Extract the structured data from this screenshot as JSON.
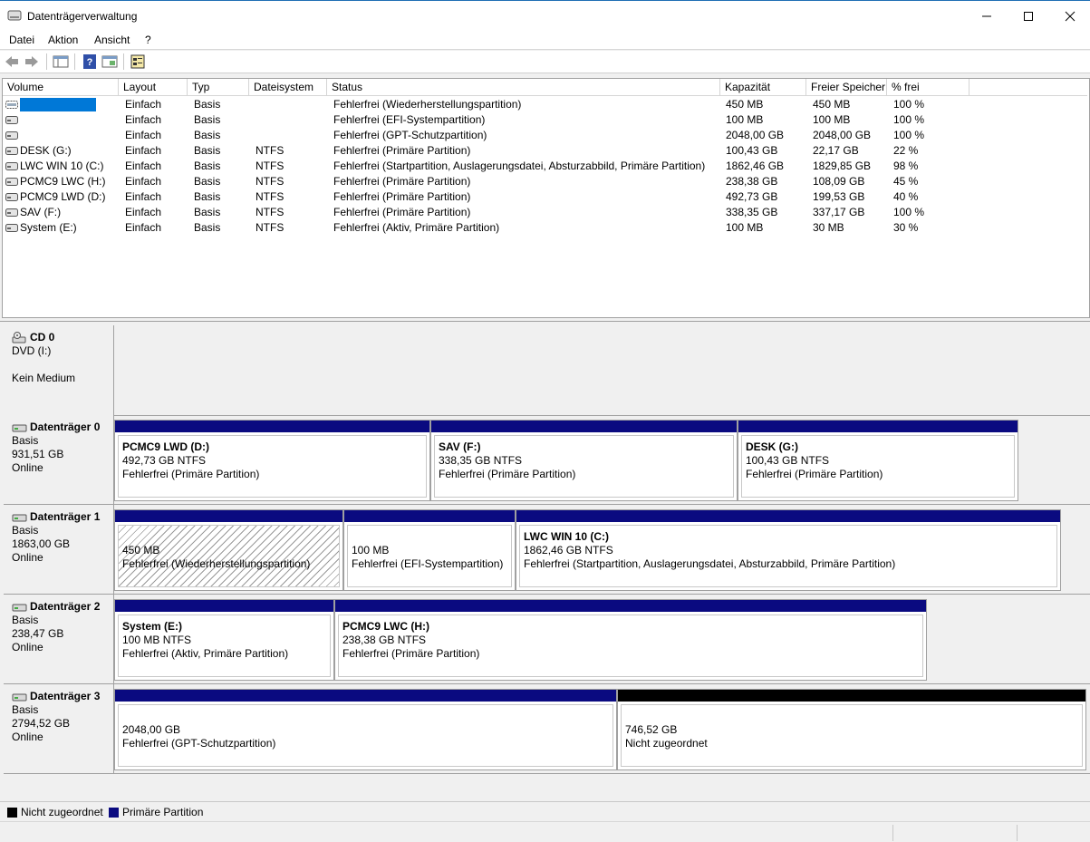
{
  "window": {
    "title": "Datenträgerverwaltung"
  },
  "menu": [
    "Datei",
    "Aktion",
    "Ansicht",
    "?"
  ],
  "volume_table": {
    "columns": [
      "Volume",
      "Layout",
      "Typ",
      "Dateisystem",
      "Status",
      "Kapazität",
      "Freier Speicher",
      "% frei"
    ],
    "rows": [
      {
        "volume": "",
        "layout": "Einfach",
        "typ": "Basis",
        "fs": "",
        "status": "Fehlerfrei (Wiederherstellungspartition)",
        "kap": "450 MB",
        "frei": "450 MB",
        "pct": "100 %",
        "selected": true
      },
      {
        "volume": "",
        "layout": "Einfach",
        "typ": "Basis",
        "fs": "",
        "status": "Fehlerfrei (EFI-Systempartition)",
        "kap": "100 MB",
        "frei": "100 MB",
        "pct": "100 %"
      },
      {
        "volume": "",
        "layout": "Einfach",
        "typ": "Basis",
        "fs": "",
        "status": "Fehlerfrei (GPT-Schutzpartition)",
        "kap": "2048,00 GB",
        "frei": "2048,00 GB",
        "pct": "100 %"
      },
      {
        "volume": "DESK (G:)",
        "layout": "Einfach",
        "typ": "Basis",
        "fs": "NTFS",
        "status": "Fehlerfrei (Primäre Partition)",
        "kap": "100,43 GB",
        "frei": "22,17 GB",
        "pct": "22 %"
      },
      {
        "volume": "LWC WIN 10  (C:)",
        "layout": "Einfach",
        "typ": "Basis",
        "fs": "NTFS",
        "status": "Fehlerfrei (Startpartition, Auslagerungsdatei, Absturzabbild, Primäre Partition)",
        "kap": "1862,46 GB",
        "frei": "1829,85 GB",
        "pct": "98 %"
      },
      {
        "volume": "PCMC9 LWC (H:)",
        "layout": "Einfach",
        "typ": "Basis",
        "fs": "NTFS",
        "status": "Fehlerfrei (Primäre Partition)",
        "kap": "238,38 GB",
        "frei": "108,09 GB",
        "pct": "45 %"
      },
      {
        "volume": "PCMC9 LWD (D:)",
        "layout": "Einfach",
        "typ": "Basis",
        "fs": "NTFS",
        "status": "Fehlerfrei (Primäre Partition)",
        "kap": "492,73 GB",
        "frei": "199,53 GB",
        "pct": "40 %"
      },
      {
        "volume": "SAV (F:)",
        "layout": "Einfach",
        "typ": "Basis",
        "fs": "NTFS",
        "status": "Fehlerfrei (Primäre Partition)",
        "kap": "338,35 GB",
        "frei": "337,17 GB",
        "pct": "100 %"
      },
      {
        "volume": "System (E:)",
        "layout": "Einfach",
        "typ": "Basis",
        "fs": "NTFS",
        "status": "Fehlerfrei (Aktiv, Primäre Partition)",
        "kap": "100 MB",
        "frei": "30 MB",
        "pct": "30 %"
      }
    ]
  },
  "disks": [
    {
      "name": "CD 0",
      "type": "DVD (I:)",
      "size": "",
      "state": "",
      "extra": "Kein Medium",
      "partitions": []
    },
    {
      "name": "Datenträger 0",
      "type": "Basis",
      "size": "931,51 GB",
      "state": "Online",
      "partitions": [
        {
          "title": "PCMC9 LWD  (D:)",
          "size": "492,73 GB NTFS",
          "status": "Fehlerfrei (Primäre Partition)",
          "bar": "primary"
        },
        {
          "title": "SAV  (F:)",
          "size": "338,35 GB NTFS",
          "status": "Fehlerfrei (Primäre Partition)",
          "bar": "primary"
        },
        {
          "title": "DESK  (G:)",
          "size": "100,43 GB NTFS",
          "status": "Fehlerfrei (Primäre Partition)",
          "bar": "primary"
        }
      ]
    },
    {
      "name": "Datenträger 1",
      "type": "Basis",
      "size": "1863,00 GB",
      "state": "Online",
      "partitions": [
        {
          "title": "",
          "size": "450 MB",
          "status": "Fehlerfrei (Wiederherstellungspartition)",
          "bar": "primary",
          "hatched": true
        },
        {
          "title": "",
          "size": "100 MB",
          "status": "Fehlerfrei (EFI-Systempartition)",
          "bar": "primary"
        },
        {
          "title": "LWC WIN 10   (C:)",
          "size": "1862,46 GB NTFS",
          "status": "Fehlerfrei (Startpartition, Auslagerungsdatei, Absturzabbild, Primäre Partition)",
          "bar": "primary"
        }
      ]
    },
    {
      "name": "Datenträger 2",
      "type": "Basis",
      "size": "238,47 GB",
      "state": "Online",
      "partitions": [
        {
          "title": "System  (E:)",
          "size": "100 MB NTFS",
          "status": "Fehlerfrei (Aktiv, Primäre Partition)",
          "bar": "primary"
        },
        {
          "title": "PCMC9 LWC  (H:)",
          "size": "238,38 GB NTFS",
          "status": "Fehlerfrei (Primäre Partition)",
          "bar": "primary"
        }
      ]
    },
    {
      "name": "Datenträger 3",
      "type": "Basis",
      "size": "2794,52 GB",
      "state": "Online",
      "partitions": [
        {
          "title": "",
          "size": "2048,00 GB",
          "status": "Fehlerfrei (GPT-Schutzpartition)",
          "bar": "primary"
        },
        {
          "title": "",
          "size": "746,52 GB",
          "status": "Nicht zugeordnet",
          "bar": "unallocated"
        }
      ]
    }
  ],
  "legend": [
    {
      "label": "Nicht zugeordnet",
      "color": "#000000"
    },
    {
      "label": "Primäre Partition",
      "color": "#0a0a80"
    }
  ],
  "colors": {
    "primary": "#0a0a80",
    "unallocated": "#000000",
    "selection": "#0078d7"
  }
}
